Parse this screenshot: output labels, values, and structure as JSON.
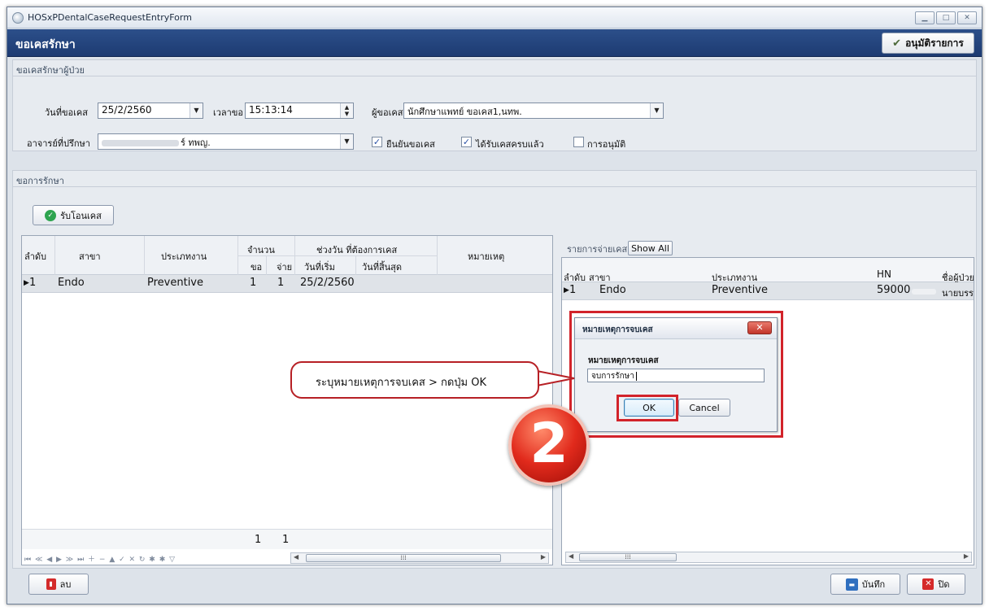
{
  "window": {
    "title": "HOSxPDentalCaseRequestEntryForm",
    "header": "ขอเคสรักษา",
    "approve_button": "อนุมัติรายการ",
    "controls": [
      "minimize",
      "maximize",
      "close"
    ]
  },
  "patient_request": {
    "group_label": "ขอเคสรักษาผู้ป่วย",
    "request_date_label": "วันที่ขอเคส",
    "request_date": "25/2/2560",
    "request_time_label": "เวลาขอ",
    "request_time": "15:13:14",
    "requester_label": "ผู้ขอเคส",
    "requester": "นักศึกษาแพทย์ ขอเคส1,นทพ.",
    "advisor_label": "อาจารย์ที่ปรึกษา",
    "advisor": "ร์ ทพญ.",
    "confirm_label": "ยืนยันขอเคส",
    "confirm_checked": true,
    "received_label": "ได้รับเคสครบแล้ว",
    "received_checked": true,
    "approved_label": "การอนุมัติ",
    "approved_checked": false
  },
  "treatment_request": {
    "group_label": "ขอการรักษา",
    "transfer_button": "รับโอนเคส",
    "grid": {
      "col_seq": "ลำดับ",
      "col_branch": "สาขา",
      "col_worktype": "ประเภทงาน",
      "col_amount": "จำนวน",
      "col_request": "ขอ",
      "col_pay": "จ่าย",
      "col_range": "ช่วงวัน ที่ต้องการเคส",
      "col_start": "วันที่เริ่ม",
      "col_end": "วันที่สิ้นสุด",
      "col_note": "หมายเหตุ",
      "rows": [
        {
          "seq": "1",
          "branch": "Endo",
          "worktype": "Preventive",
          "request": "1",
          "pay": "1",
          "start": "25/2/2560",
          "end": "",
          "note": ""
        }
      ],
      "footer_request_total": "1",
      "footer_pay_total": "1"
    }
  },
  "case_pay": {
    "label": "รายการจ่ายเคส",
    "show_all_button": "Show All",
    "grid": {
      "col_seq": "ลำดับ",
      "col_branch": "สาขา",
      "col_worktype": "ประเภทงาน",
      "col_hn": "HN",
      "col_patient": "ชื่อผู้ป่วย",
      "rows": [
        {
          "seq": "1",
          "branch": "Endo",
          "worktype": "Preventive",
          "hn": "59000",
          "patient": "นายบรร"
        }
      ]
    }
  },
  "dialog": {
    "title": "หมายเหตุการจบเคส",
    "field_label": "หมายเหตุการจบเคส",
    "field_value": "จบการรักษา",
    "ok_button": "OK",
    "cancel_button": "Cancel"
  },
  "annotation": {
    "callout_text": "ระบุหมายเหตุการจบเคส > กดปุ่ม OK",
    "step_number": "2",
    "highlight_color": "#d2232a"
  },
  "footer": {
    "delete_button": "ลบ",
    "save_button": "บันทึก",
    "close_button": "ปิด"
  }
}
